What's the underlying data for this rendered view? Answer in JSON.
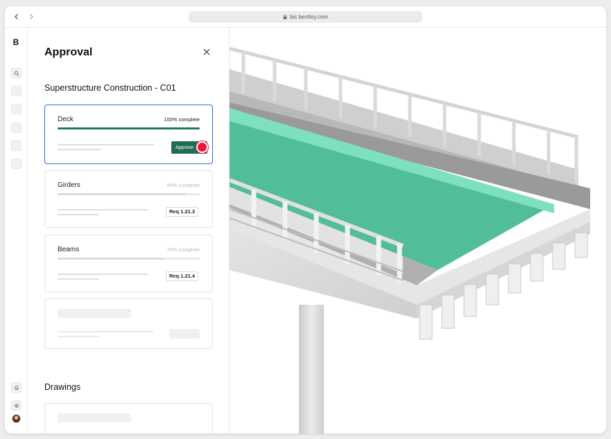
{
  "browser": {
    "url": "bic.bentley.com",
    "back_icon": "chevron-left-icon",
    "forward_icon": "chevron-right-icon",
    "lock_icon": "lock-icon"
  },
  "rail": {
    "logo": "B",
    "items": [
      {
        "icon": "search-icon"
      },
      {
        "icon": "placeholder-icon"
      },
      {
        "icon": "placeholder-icon"
      },
      {
        "icon": "placeholder-icon"
      },
      {
        "icon": "placeholder-icon"
      },
      {
        "icon": "placeholder-icon"
      }
    ],
    "bottom": [
      {
        "icon": "bell-icon"
      },
      {
        "icon": "gear-icon"
      },
      {
        "icon": "avatar"
      }
    ]
  },
  "panel": {
    "title": "Approval",
    "close_icon": "close-icon",
    "section_title": "Superstructure Construction - C01",
    "cards": [
      {
        "name": "Deck",
        "status": "100% complete",
        "progress": 1.0,
        "action": "Approve"
      },
      {
        "name": "Girders",
        "status": "90% complete",
        "progress": 0.9,
        "request": "Req 1.21.3"
      },
      {
        "name": "Beams",
        "status": "75% complete",
        "progress": 0.75,
        "request": "Req 1.21.4"
      }
    ],
    "drawings_title": "Drawings"
  },
  "colors": {
    "accent": "#1f6e52",
    "selection": "#2a6fc9",
    "highlight": "#5cc8a3",
    "cursor": "#e5173f"
  }
}
